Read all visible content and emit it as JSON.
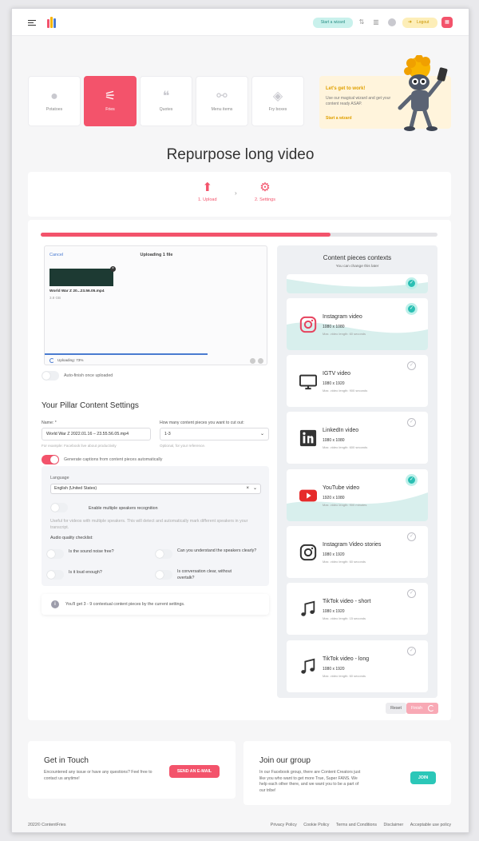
{
  "header": {
    "start_wizard": "Start a wizard",
    "logout": "Logout"
  },
  "categories": [
    {
      "label": "Potatoes",
      "icon": "potato-icon"
    },
    {
      "label": "Fries",
      "icon": "fries-icon",
      "active": true
    },
    {
      "label": "Quotes",
      "icon": "quote-icon"
    },
    {
      "label": "Menu items",
      "icon": "menu-items-icon"
    },
    {
      "label": "Fry boxes",
      "icon": "stack-icon"
    }
  ],
  "promo": {
    "title": "Let's get to work!",
    "text": "Use our magical wizard and get your content ready ASAP.",
    "link": "Start a wizard"
  },
  "page_title": "Repurpose long video",
  "steps": [
    {
      "label": "1. Upload"
    },
    {
      "label": "2. Settings"
    }
  ],
  "upload": {
    "progress_percent": 73,
    "cancel": "Cancel",
    "title": "Uploading 1 file",
    "file_name": "World War Z 20...23.56.05.mp4",
    "file_size": "3.8 GB",
    "status": "Uploading: 73%",
    "bar_fraction": 0.73,
    "auto_finish": "Auto-finish once uploaded"
  },
  "settings": {
    "heading": "Your Pillar Content Settings",
    "name_label": "Name: *",
    "name_value": "World War Z 2022.01.16 – 23.55.56.05.mp4",
    "name_hint": "For example: Facebook live about productivity",
    "pieces_label": "How many content pieces you want to cut out:",
    "pieces_value": "1-3",
    "pieces_hint": "Optional, for your reference.",
    "captions": "Generate captions from content pieces automatically",
    "language_label": "Language",
    "language_value": "English (United States)",
    "speakers": "Enable multiple speakers recognition",
    "speakers_hint": "Useful for videos with multiple speakers. This will detect and automatically mark different speakers in your transcript.",
    "checklist_title": "Audio quality checklist:",
    "checklist": [
      "Is the sound noise free?",
      "Can you understand the speakers clearly?",
      "Is it loud enough?",
      "Is conversation clear, without overtalk?"
    ],
    "info": "You'll get 3 - 9 contextual content pieces by the current settings."
  },
  "contexts": {
    "title": "Content pieces contexts",
    "subtitle": "You can change this later",
    "items": [
      {
        "name": "Instagram video",
        "dims": "1080 x 1080",
        "max": "Max. video length: 60 seconds",
        "selected": true,
        "icon": "instagram-icon"
      },
      {
        "name": "IGTV video",
        "dims": "1080 x 1920",
        "max": "Max. video length: 900 seconds",
        "selected": false,
        "icon": "tv-icon"
      },
      {
        "name": "LinkedIn video",
        "dims": "1080 x 1080",
        "max": "Max. video length: 600 seconds",
        "selected": false,
        "icon": "linkedin-icon"
      },
      {
        "name": "YouTube video",
        "dims": "1920 x 1080",
        "max": "Max. video length: 900 minutes",
        "selected": true,
        "icon": "youtube-icon"
      },
      {
        "name": "Instagram Video stories",
        "dims": "1080 x 1920",
        "max": "Max. video length: 60 seconds",
        "selected": false,
        "icon": "instagram-icon"
      },
      {
        "name": "TikTok video - short",
        "dims": "1080 x 1920",
        "max": "Max. video length: 15 seconds",
        "selected": false,
        "icon": "music-note-icon"
      },
      {
        "name": "TikTok video - long",
        "dims": "1080 x 1920",
        "max": "Max. video length: 60 seconds",
        "selected": false,
        "icon": "music-note-icon"
      }
    ]
  },
  "buttons": {
    "reset": "Reset",
    "finish": "Finish"
  },
  "footer": {
    "touch_title": "Get in Touch",
    "touch_text": "Encountered any issue or have any questions? Feel free to contact us anytime!",
    "email_button": "SEND AN E-MAIL",
    "group_title": "Join our group",
    "group_text": "In our Facebook group, there are Content Creators just like you who want to get more True, Super FANS. We help each other there, and we want you to be a part of our tribe!",
    "join_button": "JOIN",
    "copyright": "2022© ContentFries",
    "links": [
      "Privacy Policy",
      "Cookie Policy",
      "Terms and Conditions",
      "Disclaimer",
      "Acceptable use policy"
    ]
  },
  "colors": {
    "accent": "#f3536b",
    "teal": "#2bc7b8",
    "yellow": "#fdeeb8"
  }
}
